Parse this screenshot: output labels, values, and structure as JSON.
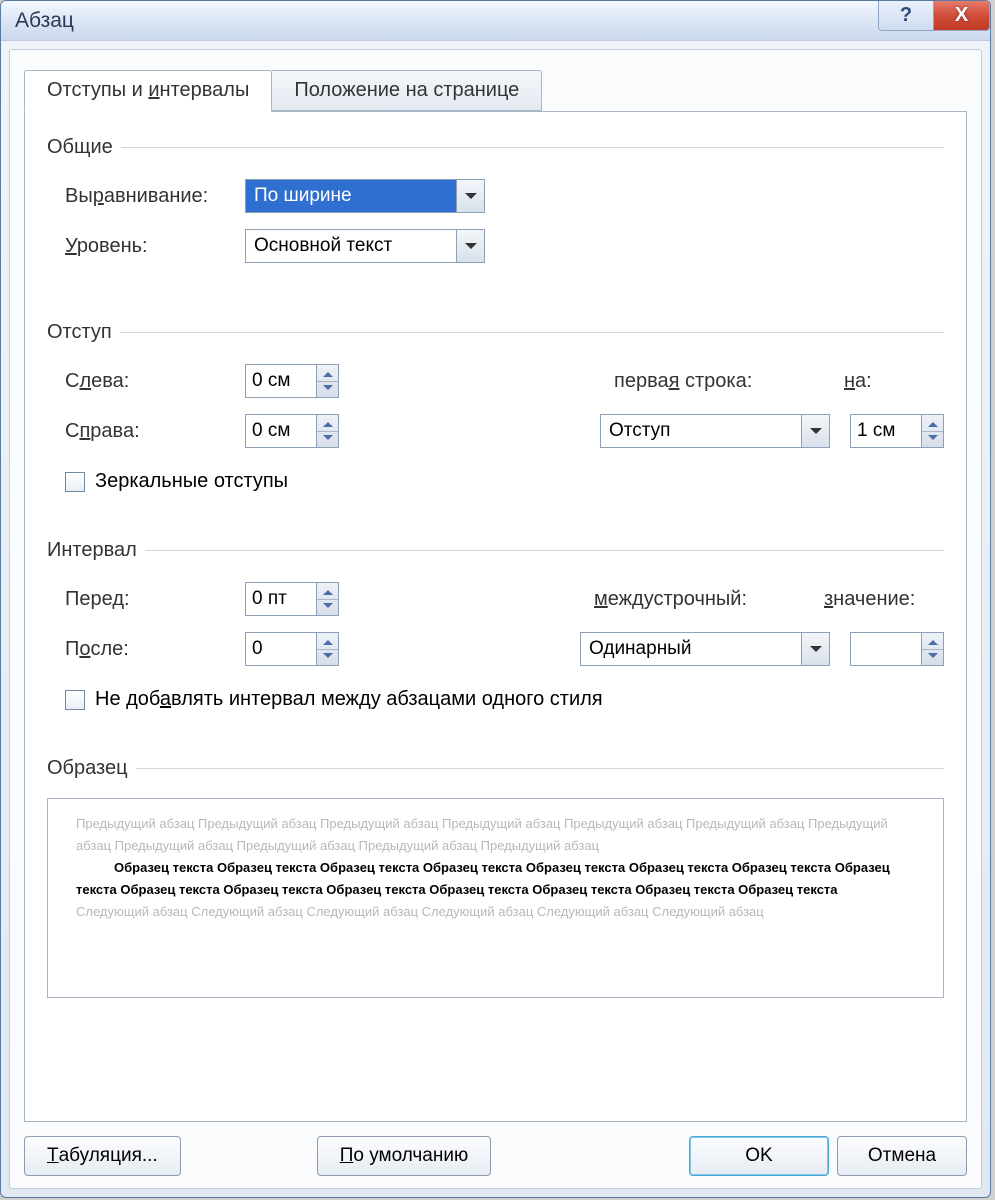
{
  "window": {
    "title": "Абзац"
  },
  "tabs": {
    "active": "Отступы и интервалы",
    "other": "Положение на странице"
  },
  "general": {
    "title": "Общие",
    "alignment_label": "Выравнивание:",
    "alignment_value": "По ширине",
    "level_label": "Уровень:",
    "level_value": "Основной текст"
  },
  "indent": {
    "title": "Отступ",
    "left_label": "Слева:",
    "left_value": "0 см",
    "right_label": "Справа:",
    "right_value": "0 см",
    "firstline_label": "первая строка:",
    "firstline_value": "Отступ",
    "by_label": "на:",
    "by_value": "1 см",
    "mirror_label": "Зеркальные отступы",
    "mirror_checked": false
  },
  "spacing": {
    "title": "Интервал",
    "before_label": "Перед:",
    "before_value": "0 пт",
    "after_label": "После:",
    "after_value": "0",
    "line_label": "междустрочный:",
    "line_value": "Одинарный",
    "at_label": "значение:",
    "at_value": "",
    "noadd_label": "Не добавлять интервал между абзацами одного стиля",
    "noadd_checked": false
  },
  "preview": {
    "title": "Образец",
    "prev_text": "Предыдущий абзац Предыдущий абзац Предыдущий абзац Предыдущий абзац Предыдущий абзац Предыдущий абзац Предыдущий абзац Предыдущий абзац Предыдущий абзац Предыдущий абзац Предыдущий абзац",
    "sample_text": "Образец текста Образец текста Образец текста Образец текста Образец текста Образец текста Образец текста Образец текста Образец текста Образец текста Образец текста Образец текста Образец текста Образец текста Образец текста",
    "next_text": "Следующий абзац Следующий абзац Следующий абзац Следующий абзац Следующий абзац Следующий абзац"
  },
  "buttons": {
    "tabs": "Табуляция...",
    "default": "По умолчанию",
    "ok": "OK",
    "cancel": "Отмена"
  }
}
